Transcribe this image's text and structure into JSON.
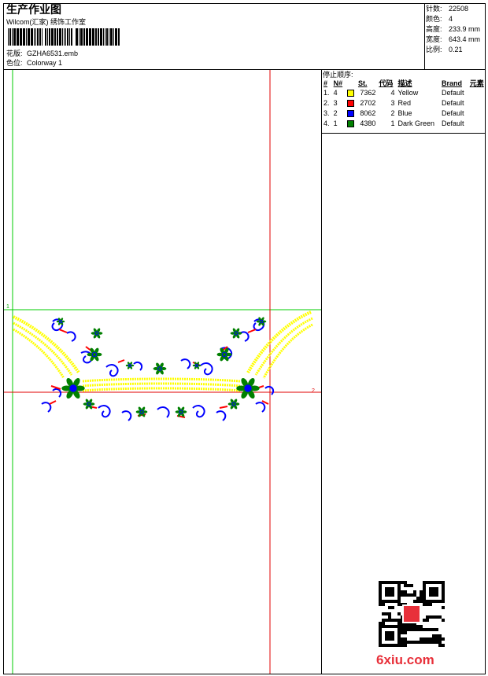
{
  "header": {
    "title": "生产作业图",
    "company": "Wilcom(汇家) 绣饰工作室",
    "design_label": "花版:",
    "design_value": "GZHA6531.emb",
    "colorway_label": "色位:",
    "colorway_value": "Colorway 1"
  },
  "stats": [
    {
      "label": "针数:",
      "value": "22508"
    },
    {
      "label": "颜色:",
      "value": "4"
    },
    {
      "label": "高度:",
      "value": "233.9 mm"
    },
    {
      "label": "宽度:",
      "value": "643.4 mm"
    },
    {
      "label": "比例:",
      "value": "0.21"
    }
  ],
  "stop_sequence": {
    "title": "停止顺序:",
    "headers": {
      "num": "#",
      "n": "N#",
      "st": "St.",
      "code": "代码",
      "desc": "描述",
      "brand": "Brand",
      "elem": "元素"
    },
    "rows": [
      {
        "num": "1.",
        "n": "4",
        "color": "#ffff00",
        "st": "7362",
        "code": "4",
        "desc": "Yellow",
        "brand": "Default"
      },
      {
        "num": "2.",
        "n": "3",
        "color": "#ff0000",
        "st": "2702",
        "code": "3",
        "desc": "Red",
        "brand": "Default"
      },
      {
        "num": "3.",
        "n": "2",
        "color": "#0000ff",
        "st": "8062",
        "code": "2",
        "desc": "Blue",
        "brand": "Default"
      },
      {
        "num": "4.",
        "n": "1",
        "color": "#008000",
        "st": "4380",
        "code": "1",
        "desc": "Dark Green",
        "brand": "Default"
      }
    ]
  },
  "colors": {
    "guide_green": "#00cc00",
    "guide_red": "#e00000",
    "yellow": "#ffff00",
    "blue": "#0000ff",
    "red": "#ff0000",
    "green": "#008000"
  },
  "watermark": "6xiu.com"
}
